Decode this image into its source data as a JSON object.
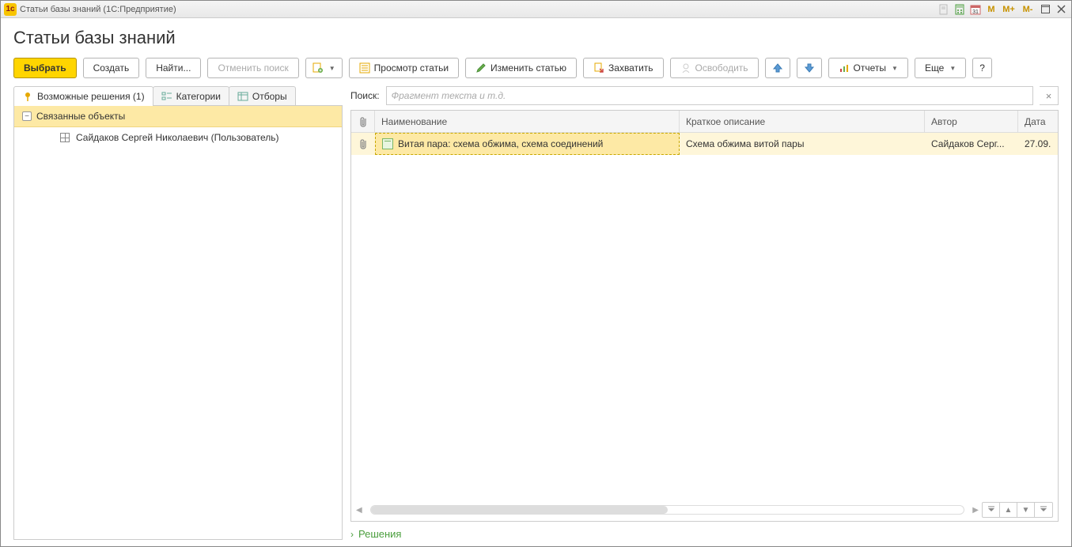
{
  "titlebar": {
    "text": "Статьи базы знаний  (1С:Предприятие)"
  },
  "page_title": "Статьи базы знаний",
  "toolbar": {
    "select": "Выбрать",
    "create": "Создать",
    "find": "Найти...",
    "cancel_search": "Отменить поиск",
    "view_article": "Просмотр статьи",
    "edit_article": "Изменить статью",
    "capture": "Захватить",
    "release": "Освободить",
    "reports": "Отчеты",
    "more": "Еще",
    "help": "?"
  },
  "tabs": {
    "solutions": "Возможные решения (1)",
    "categories": "Категории",
    "filters": "Отборы"
  },
  "tree": {
    "header": "Связанные объекты",
    "item1": "Сайдаков Сергей Николаевич (Пользователь)"
  },
  "search": {
    "label": "Поиск:",
    "placeholder": "Фрагмент текста и т.д."
  },
  "columns": {
    "name": "Наименование",
    "desc": "Краткое описание",
    "author": "Автор",
    "date": "Дата"
  },
  "rows": [
    {
      "name": "Витая пара: схема обжима, схема соединений",
      "desc": "Схема обжима витой пары",
      "author": "Сайдаков Серг...",
      "date": "27.09."
    }
  ],
  "solutions_footer": "Решения"
}
